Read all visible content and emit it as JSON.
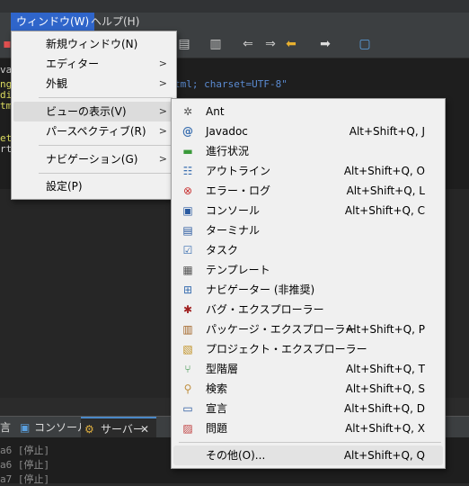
{
  "menubar": {
    "window": "ウィンドウ(W)",
    "help": "ヘルプ(H)"
  },
  "editor": {
    "lines": [
      {
        "left": "va",
        "right": ""
      },
      {
        "left": "ng",
        "right": "tml; charset=UTF-8\""
      },
      {
        "left": "di",
        "right": ""
      },
      {
        "left": "tm",
        "right": ""
      },
      {
        "left": "et",
        "right": ""
      },
      {
        "left": "rt",
        "right": ""
      }
    ]
  },
  "bottom": {
    "tab_partial": "言",
    "tab_console": "コンソール",
    "tab_servers": "サーバー",
    "server_lines": [
      "a6 [停止]",
      "a6 [停止]",
      "a7 [停止]"
    ]
  },
  "window_menu": {
    "items": [
      {
        "label": "新規ウィンドウ(N)",
        "arrow": ""
      },
      {
        "label": "エディター",
        "arrow": ">"
      },
      {
        "label": "外観",
        "arrow": ">"
      },
      {
        "label": "ビューの表示(V)",
        "arrow": ">"
      },
      {
        "label": "パースペクティブ(R)",
        "arrow": ">"
      },
      {
        "label": "ナビゲーション(G)",
        "arrow": ">"
      },
      {
        "label": "設定(P)",
        "arrow": ""
      }
    ]
  },
  "view_menu": {
    "items": [
      {
        "label": "Ant",
        "shortcut": "",
        "icon": "ant-icon",
        "glyph": "🐜"
      },
      {
        "label": "Javadoc",
        "shortcut": "Alt+Shift+Q, J",
        "icon": "javadoc-icon",
        "glyph": "@"
      },
      {
        "label": "進行状況",
        "shortcut": "",
        "icon": "progress-icon",
        "glyph": "▬"
      },
      {
        "label": "アウトライン",
        "shortcut": "Alt+Shift+Q, O",
        "icon": "outline-icon",
        "glyph": "☷"
      },
      {
        "label": "エラー・ログ",
        "shortcut": "Alt+Shift+Q, L",
        "icon": "error-log-icon",
        "glyph": "⊗"
      },
      {
        "label": "コンソール",
        "shortcut": "Alt+Shift+Q, C",
        "icon": "console-icon",
        "glyph": "▣"
      },
      {
        "label": "ターミナル",
        "shortcut": "",
        "icon": "terminal-icon",
        "glyph": "▤"
      },
      {
        "label": "タスク",
        "shortcut": "",
        "icon": "tasks-icon",
        "glyph": "☑"
      },
      {
        "label": "テンプレート",
        "shortcut": "",
        "icon": "templates-icon",
        "glyph": "▦"
      },
      {
        "label": "ナビゲーター (非推奨)",
        "shortcut": "",
        "icon": "navigator-icon",
        "glyph": "⊞"
      },
      {
        "label": "バグ・エクスプローラー",
        "shortcut": "",
        "icon": "bug-icon",
        "glyph": "✱"
      },
      {
        "label": "パッケージ・エクスプローラー",
        "shortcut": "Alt+Shift+Q, P",
        "icon": "package-explorer-icon",
        "glyph": "▥"
      },
      {
        "label": "プロジェクト・エクスプローラー",
        "shortcut": "",
        "icon": "project-explorer-icon",
        "glyph": "▧"
      },
      {
        "label": "型階層",
        "shortcut": "Alt+Shift+Q, T",
        "icon": "type-hierarchy-icon",
        "glyph": "⑂"
      },
      {
        "label": "検索",
        "shortcut": "Alt+Shift+Q, S",
        "icon": "search-icon",
        "glyph": "⚲"
      },
      {
        "label": "宣言",
        "shortcut": "Alt+Shift+Q, D",
        "icon": "declaration-icon",
        "glyph": "▭"
      },
      {
        "label": "問題",
        "shortcut": "Alt+Shift+Q, X",
        "icon": "problems-icon",
        "glyph": "▨"
      },
      {
        "label": "その他(O)...",
        "shortcut": "Alt+Shift+Q, Q",
        "icon": "",
        "glyph": ""
      }
    ]
  },
  "colors": {
    "menu_bg": "#f0f0f0",
    "menubar_active": "#2f65ca",
    "highlight": "#dcdcdc"
  }
}
